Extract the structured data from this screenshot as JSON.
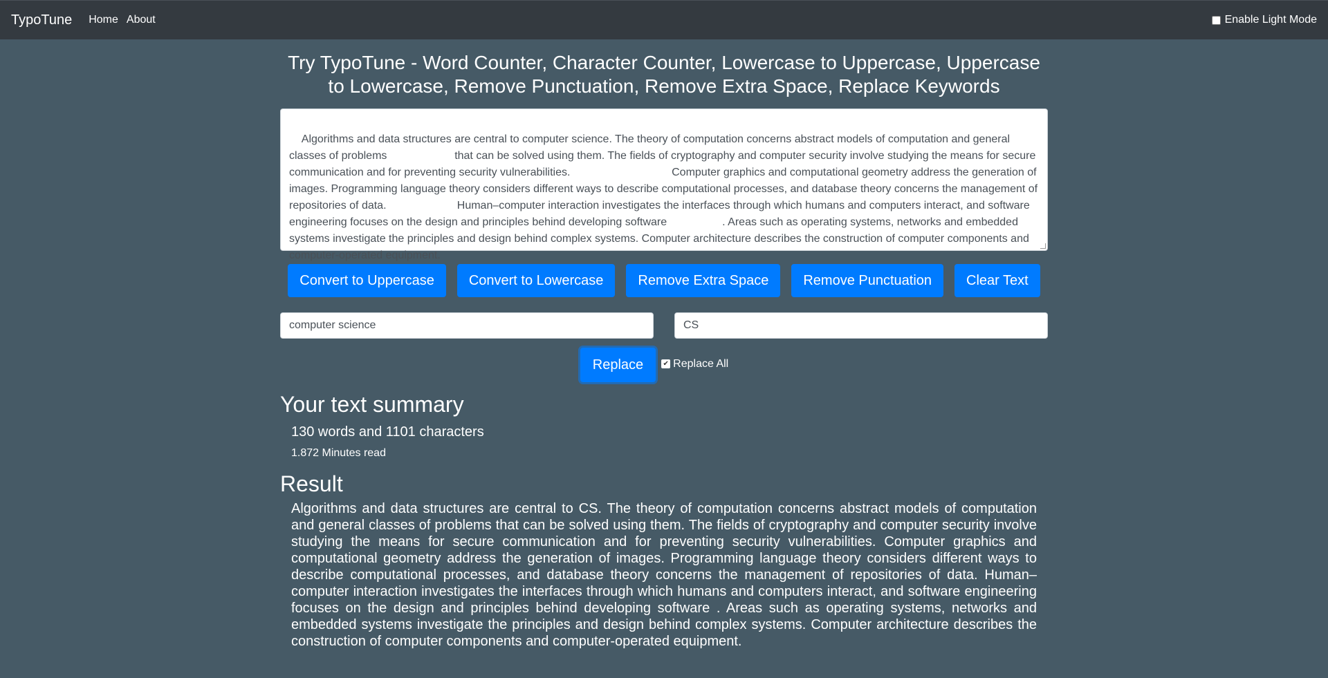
{
  "nav": {
    "brand": "TypoTune",
    "links": [
      "Home",
      "About"
    ],
    "light_mode_label": "Enable Light Mode",
    "light_mode_checked": false
  },
  "main": {
    "heading": "Try TypoTune - Word Counter, Character Counter, Lowercase to Uppercase, Uppercase to Lowercase, Remove Punctuation, Remove Extra Space, Replace Keywords",
    "textarea_value": "Algorithms and data structures are central to computer science. The theory of computation concerns abstract models of computation and general classes of problems                      that can be solved using them. The fields of cryptography and computer security involve studying the means for secure communication and for preventing security vulnerabilities.                                 Computer graphics and computational geometry address the generation of images. Programming language theory considers different ways to describe computational processes, and database theory concerns the management of repositories of data.                       Human–computer interaction investigates the interfaces through which humans and computers interact, and software engineering focuses on the design and principles behind developing software                  . Areas such as operating systems, networks and embedded systems investigate the principles and design behind complex systems. Computer architecture describes the construction of computer components and computer-operated equipment.",
    "buttons": {
      "uppercase": "Convert to Uppercase",
      "lowercase": "Convert to Lowercase",
      "extra_space": "Remove Extra Space",
      "punctuation": "Remove Punctuation",
      "clear": "Clear Text"
    },
    "find_value": "computer science",
    "replace_value": "CS",
    "replace_button": "Replace",
    "replace_all_label": "Replace All",
    "replace_all_checked": true
  },
  "summary": {
    "heading": "Your text summary",
    "counts": "130 words and 1101 characters",
    "read_time": "1.872 Minutes read"
  },
  "result": {
    "heading": "Result",
    "text": "Algorithms and data structures are central to CS. The theory of computation concerns abstract models of computation and general classes of problems that can be solved using them. The fields of cryptography and computer security involve studying the means for secure communication and for preventing security vulnerabilities. Computer graphics and computational geometry address the generation of images. Programming language theory considers different ways to describe computational processes, and database theory concerns the management of repositories of data. Human–computer interaction investigates the interfaces through which humans and computers interact, and software engineering focuses on the design and principles behind developing software . Areas such as operating systems, networks and embedded systems investigate the principles and design behind complex systems. Computer architecture describes the construction of computer components and computer-operated equipment."
  }
}
